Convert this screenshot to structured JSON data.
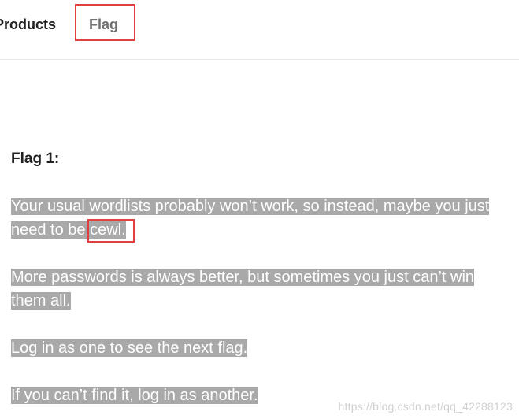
{
  "nav": {
    "items": [
      {
        "label": "Products"
      },
      {
        "label": "Flag"
      }
    ]
  },
  "content": {
    "heading": "Flag 1:",
    "paragraphs": [
      {
        "before": "Your usual wordlists probably won’t work, so instead, maybe you just need to be",
        "highlight": "cewl",
        "after": "."
      },
      {
        "text": "More passwords is always better, but sometimes you just can’t win them all."
      },
      {
        "text": "Log in as one to see the next flag."
      },
      {
        "text": "If you can’t find it, log in as another."
      }
    ]
  },
  "watermark": "https://blog.csdn.net/qq_42288123",
  "colors": {
    "annotation": "#e0403f",
    "highlight_bg": "#a9a9a9"
  }
}
